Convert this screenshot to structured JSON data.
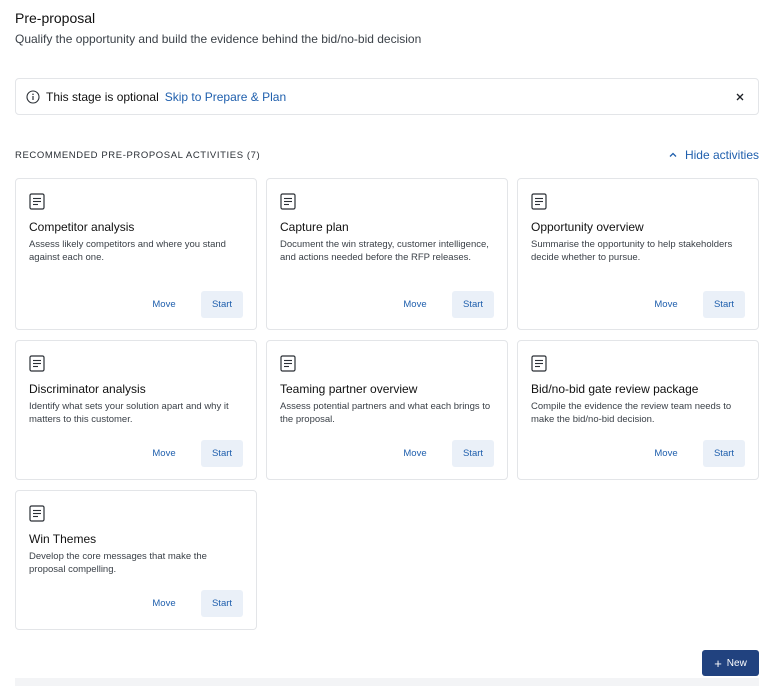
{
  "header": {
    "title": "Pre-proposal",
    "subtitle": "Qualify the opportunity and build the evidence behind the bid/no-bid decision"
  },
  "banner": {
    "text": "This stage is optional",
    "link": "Skip to Prepare & Plan",
    "close_glyph": "×"
  },
  "section": {
    "title": "RECOMMENDED PRE-PROPOSAL ACTIVITIES (7)",
    "toggle_label": "Hide activities"
  },
  "activities": [
    {
      "title": "Competitor analysis",
      "description": "Assess likely competitors and where you stand against each one.",
      "move": "Move",
      "start": "Start"
    },
    {
      "title": "Capture plan",
      "description": "Document the win strategy, customer intelligence, and actions needed before the RFP releases.",
      "move": "Move",
      "start": "Start"
    },
    {
      "title": "Opportunity overview",
      "description": "Summarise the opportunity to help stakeholders decide whether to pursue.",
      "move": "Move",
      "start": "Start"
    },
    {
      "title": "Discriminator analysis",
      "description": "Identify what sets your solution apart and why it matters to this customer.",
      "move": "Move",
      "start": "Start"
    },
    {
      "title": "Teaming partner overview",
      "description": "Assess potential partners and what each brings to the proposal.",
      "move": "Move",
      "start": "Start"
    },
    {
      "title": "Bid/no-bid gate review package",
      "description": "Compile the evidence the review team needs to make the bid/no-bid decision.",
      "move": "Move",
      "start": "Start"
    },
    {
      "title": "Win Themes",
      "description": "Develop the core messages that make the proposal compelling.",
      "move": "Move",
      "start": "Start"
    }
  ],
  "new_button": {
    "label": "New",
    "icon": "+"
  },
  "colors": {
    "accent": "#1f5fad",
    "primary_button": "#21427f",
    "start_button_bg": "#eaf0f8",
    "border": "#e3e5e8"
  },
  "icons": {
    "banner": "info-icon",
    "close": "close-icon",
    "toggle": "chevron-up-icon",
    "card": "document-icon"
  }
}
